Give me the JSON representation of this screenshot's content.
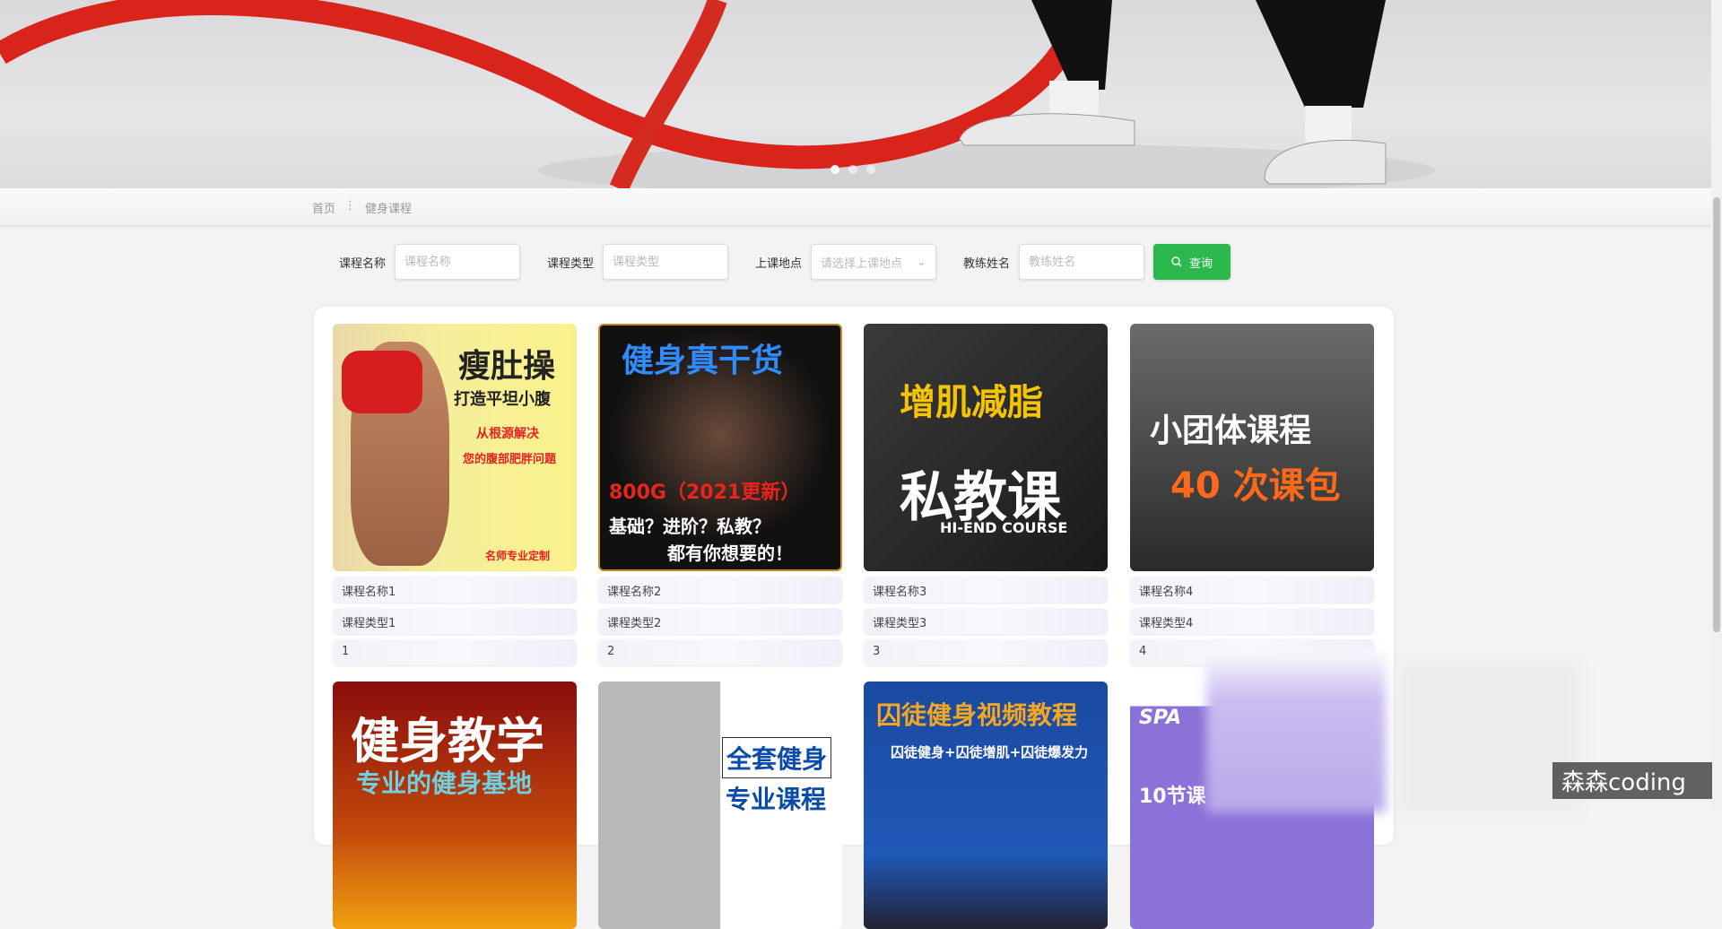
{
  "banner": {
    "slides": 3,
    "active_slide": 1
  },
  "breadcrumb": {
    "home": "首页",
    "separator": "⋮",
    "current": "健身课程"
  },
  "search": {
    "course_name_label": "课程名称",
    "course_name_placeholder": "课程名称",
    "course_type_label": "课程类型",
    "course_type_placeholder": "课程类型",
    "location_label": "上课地点",
    "location_placeholder": "请选择上课地点",
    "coach_label": "教练姓名",
    "coach_placeholder": "教练姓名",
    "button": "查询",
    "button_icon": "search-icon",
    "button_color": "#2db84d"
  },
  "courses": [
    {
      "name": "课程名称1",
      "type": "课程类型1",
      "value": "1",
      "poster": {
        "title": "瘦肚操",
        "sub": "打造平坦小腹",
        "l1": "从根源解决",
        "l2": "您的腹部肥胖问题",
        "l3": "名师专业定制"
      }
    },
    {
      "name": "课程名称2",
      "type": "课程类型2",
      "value": "2",
      "poster": {
        "title": "健身真干货",
        "sub": "800G（2021更新）",
        "l1": "基础？进阶？私教？",
        "l2": "都有你想要的！"
      }
    },
    {
      "name": "课程名称3",
      "type": "课程类型3",
      "value": "3",
      "poster": {
        "title": "增肌减脂",
        "sub": "私教课",
        "l1": "HI-END COURSE"
      }
    },
    {
      "name": "课程名称4",
      "type": "课程类型4",
      "value": "4",
      "poster": {
        "title": "小团体课程",
        "sub": "40 次课包"
      }
    }
  ],
  "courses_row2": [
    {
      "poster": {
        "title": "健身教学",
        "sub": "专业的健身基地"
      }
    },
    {
      "poster": {
        "title": "全套健身",
        "sub": "专业课程"
      }
    },
    {
      "poster": {
        "title": "囚徒健身视频教程",
        "sub": "囚徒健身+囚徒增肌+囚徒爆发力"
      }
    },
    {
      "poster": {
        "title": "SPA",
        "sub": "10节课"
      }
    }
  ],
  "watermark": "森森coding"
}
